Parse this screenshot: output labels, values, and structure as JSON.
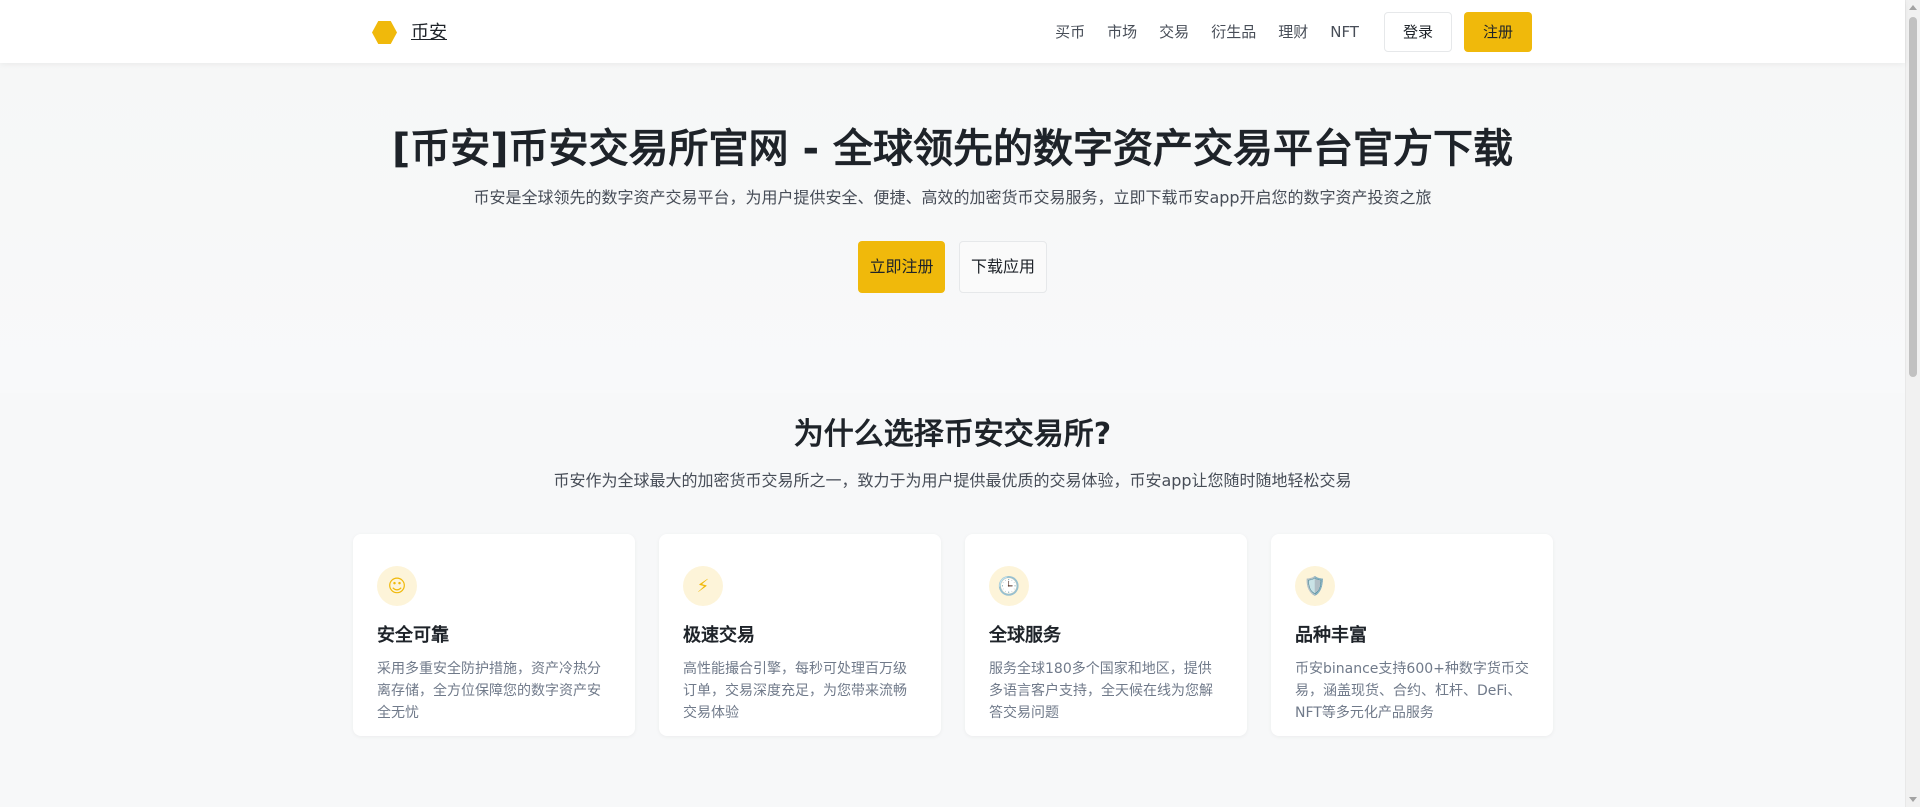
{
  "brand": {
    "name": "币安",
    "logo_icon": "hexagon-logo-icon",
    "accent": "#f0b90b"
  },
  "nav": {
    "items": [
      "买币",
      "市场",
      "交易",
      "衍生品",
      "理财",
      "NFT"
    ],
    "login_label": "登录",
    "register_label": "注册"
  },
  "hero": {
    "title": "[币安]币安交易所官网 - 全球领先的数字资产交易平台官方下载",
    "subtitle": "币安是全球领先的数字资产交易平台，为用户提供安全、便捷、高效的加密货币交易服务，立即下载币安app开启您的数字资产投资之旅",
    "primary_button": "立即注册",
    "secondary_button": "下载应用"
  },
  "why": {
    "title": "为什么选择币安交易所?",
    "subtitle": "币安作为全球最大的加密货币交易所之一，致力于为用户提供最优质的交易体验，币安app让您随时随地轻松交易",
    "cards": [
      {
        "icon": "smile-icon",
        "glyph": "☺",
        "title": "安全可靠",
        "desc": "采用多重安全防护措施，资产冷热分离存储，全方位保障您的数字资产安全无忧"
      },
      {
        "icon": "lightning-icon",
        "glyph": "⚡",
        "title": "极速交易",
        "desc": "高性能撮合引擎，每秒可处理百万级订单，交易深度充足，为您带来流畅交易体验"
      },
      {
        "icon": "clock-icon",
        "glyph": "🕒",
        "title": "全球服务",
        "desc": "服务全球180多个国家和地区，提供多语言客户支持，全天候在线为您解答交易问题"
      },
      {
        "icon": "shield-icon",
        "glyph": "🛡️",
        "title": "品种丰富",
        "desc": "币安binance支持600+种数字货币交易，涵盖现货、合约、杠杆、DeFi、NFT等多元化产品服务"
      }
    ]
  }
}
